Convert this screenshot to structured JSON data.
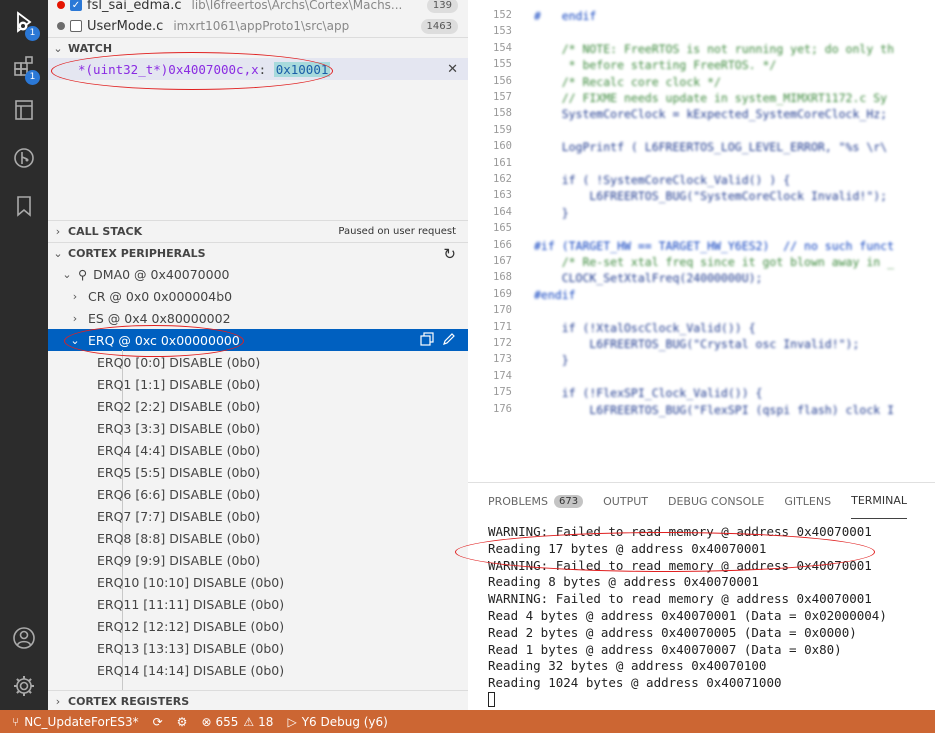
{
  "activity_bar": {
    "run_debug_badge": "1",
    "extensions_badge": "1",
    "icons": [
      "run-debug-icon",
      "extensions-icon",
      "notebook-icon",
      "source-control-icon",
      "bookmark-icon",
      "account-icon",
      "gear-icon"
    ]
  },
  "open_editors": [
    {
      "name": "fsl_sai_edma.c",
      "path": "lib\\l6freertos\\Archs\\Cortex\\Machs...",
      "count": "139",
      "dot_color": "#e51400",
      "checked": true
    },
    {
      "name": "UserMode.c",
      "path": "imxrt1061\\appProto1\\src\\app",
      "count": "1463",
      "dot_color": "#6c6c6c",
      "checked": false
    }
  ],
  "watch": {
    "title": "WATCH",
    "expression": "*(uint32_t*)0x4007000c,x",
    "separator": ": ",
    "value": "0x10001"
  },
  "call_stack": {
    "title": "CALL STACK",
    "status": "Paused on user request"
  },
  "peripherals": {
    "title": "CORTEX PERIPHERALS",
    "device": "DMA0 @ 0x40070000",
    "registers": [
      "CR @ 0x0 0x000004b0",
      "ES @ 0x4 0x80000002"
    ],
    "selected": "ERQ @ 0xc 0x00000000",
    "fields": [
      "ERQ0 [0:0] DISABLE (0b0)",
      "ERQ1 [1:1] DISABLE (0b0)",
      "ERQ2 [2:2] DISABLE (0b0)",
      "ERQ3 [3:3] DISABLE (0b0)",
      "ERQ4 [4:4] DISABLE (0b0)",
      "ERQ5 [5:5] DISABLE (0b0)",
      "ERQ6 [6:6] DISABLE (0b0)",
      "ERQ7 [7:7] DISABLE (0b0)",
      "ERQ8 [8:8] DISABLE (0b0)",
      "ERQ9 [9:9] DISABLE (0b0)",
      "ERQ10 [10:10] DISABLE (0b0)",
      "ERQ11 [11:11] DISABLE (0b0)",
      "ERQ12 [12:12] DISABLE (0b0)",
      "ERQ13 [13:13] DISABLE (0b0)",
      "ERQ14 [14:14] DISABLE (0b0)"
    ]
  },
  "cortex_registers": {
    "title": "CORTEX REGISTERS"
  },
  "editor": {
    "lines": [
      {
        "n": "152",
        "code": "#   endif"
      },
      {
        "n": "153",
        "code": ""
      },
      {
        "n": "154",
        "code": "    /* NOTE: FreeRTOS is not running yet; do only th"
      },
      {
        "n": "155",
        "code": "     * before starting FreeRTOS. */"
      },
      {
        "n": "156",
        "code": "    /* Recalc core clock */"
      },
      {
        "n": "157",
        "code": "    // FIXME needs update in system_MIMXRT1172.c Sy"
      },
      {
        "n": "158",
        "code": "    SystemCoreClock = kExpected_SystemCoreClock_Hz;"
      },
      {
        "n": "159",
        "code": ""
      },
      {
        "n": "160",
        "code": "    LogPrintf ( L6FREERTOS_LOG_LEVEL_ERROR, \"%s \\r\\"
      },
      {
        "n": "161",
        "code": ""
      },
      {
        "n": "162",
        "code": "    if ( !SystemCoreClock_Valid() ) {"
      },
      {
        "n": "163",
        "code": "        L6FREERTOS_BUG(\"SystemCoreClock Invalid!\");"
      },
      {
        "n": "164",
        "code": "    }"
      },
      {
        "n": "165",
        "code": ""
      },
      {
        "n": "166",
        "code": "#if (TARGET_HW == TARGET_HW_Y6ES2)  // no such funct"
      },
      {
        "n": "167",
        "code": "    /* Re-set xtal freq since it got blown away in _"
      },
      {
        "n": "168",
        "code": "    CLOCK_SetXtalFreq(24000000U);"
      },
      {
        "n": "169",
        "code": "#endif"
      },
      {
        "n": "170",
        "code": ""
      },
      {
        "n": "171",
        "code": "    if (!XtalOscClock_Valid()) {"
      },
      {
        "n": "172",
        "code": "        L6FREERTOS_BUG(\"Crystal osc Invalid!\");"
      },
      {
        "n": "173",
        "code": "    }"
      },
      {
        "n": "174",
        "code": ""
      },
      {
        "n": "175",
        "code": "    if (!FlexSPI_Clock_Valid()) {"
      },
      {
        "n": "176",
        "code": "        L6FREERTOS_BUG(\"FlexSPI (qspi flash) clock I"
      }
    ]
  },
  "panel": {
    "tabs": [
      {
        "label": "PROBLEMS",
        "badge": "673"
      },
      {
        "label": "OUTPUT"
      },
      {
        "label": "DEBUG CONSOLE"
      },
      {
        "label": "GITLENS"
      },
      {
        "label": "TERMINAL",
        "active": true
      }
    ],
    "terminal_lines": [
      "WARNING: Failed to read memory @ address 0x40070001",
      "Reading 17 bytes @ address 0x40070001",
      "WARNING: Failed to read memory @ address 0x40070001",
      "Reading 8 bytes @ address 0x40070001",
      "WARNING: Failed to read memory @ address 0x40070001",
      "Read 4 bytes @ address 0x40070001 (Data = 0x02000004)",
      "Read 2 bytes @ address 0x40070005 (Data = 0x0000)",
      "Read 1 bytes @ address 0x40070007 (Data = 0x80)",
      "Reading 32 bytes @ address 0x40070100",
      "Reading 1024 bytes @ address 0x40071000"
    ]
  },
  "status_bar": {
    "branch": "NC_UpdateForES3*",
    "errors": "655",
    "warnings": "18",
    "debug_config": "Y6 Debug (y6)",
    "color": "#cc6633"
  },
  "annotation_color": "#e02020"
}
